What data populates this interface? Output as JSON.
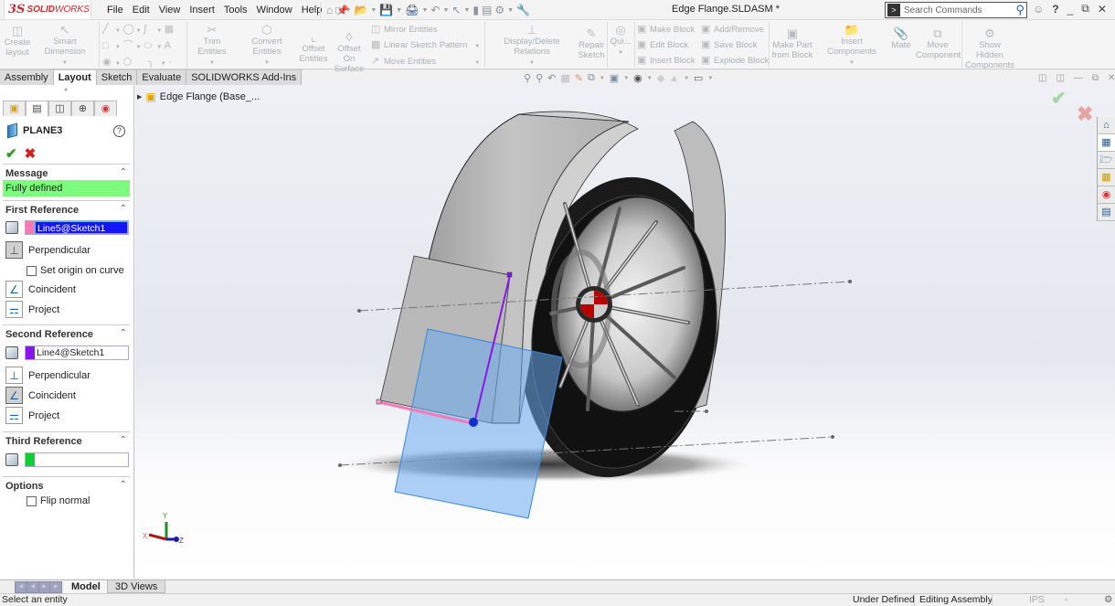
{
  "app": {
    "logo_ds": "3S",
    "logo_solid": "SOLID",
    "logo_works": "WORKS",
    "document_title": "Edge Flange.SLDASM *"
  },
  "menu": [
    "File",
    "Edit",
    "View",
    "Insert",
    "Tools",
    "Window",
    "Help"
  ],
  "quick_access_icons": [
    "home-icon",
    "new-document-icon",
    "open-icon",
    "save-icon",
    "print-icon",
    "undo-icon",
    "select-icon",
    "rebuild-icon",
    "file-properties-icon",
    "options-icon",
    "measure-icon"
  ],
  "search": {
    "placeholder": "Search Commands"
  },
  "window_controls": {
    "user": "user-icon",
    "help": "?",
    "minimize": "_",
    "restore": "restore-icon",
    "close": "X"
  },
  "ribbon": {
    "create_layout": [
      "Create",
      "layout"
    ],
    "smart_dimension": "Smart Dimension",
    "trim_entities": "Trim Entities",
    "convert_entities": "Convert Entities",
    "offset_entities": [
      "Offset",
      "Entities"
    ],
    "offset_on_surface": [
      "Offset On",
      "Surface"
    ],
    "mirror_entities": "Mirror Entities",
    "linear_sketch_pattern": "Linear Sketch Pattern",
    "move_entities": "Move Entities",
    "display_delete_relations": "Display/Delete Relations",
    "repair_sketch": [
      "Repair",
      "Sketch"
    ],
    "quick_snaps": "Qui...",
    "make_block": "Make Block",
    "edit_block": "Edit Block",
    "insert_block": "Insert Block",
    "add_remove": "Add/Remove",
    "save_block": "Save Block",
    "explode_block": "Explode Block",
    "make_part_from_block": [
      "Make Part",
      "from Block"
    ],
    "insert_components": "Insert Components",
    "mate": "Mate",
    "move_component": [
      "Move",
      "Component"
    ],
    "show_hidden_components": [
      "Show Hidden",
      "Components"
    ]
  },
  "tabs": [
    {
      "label": "Assembly",
      "active": false
    },
    {
      "label": "Layout",
      "active": true
    },
    {
      "label": "Sketch",
      "active": false
    },
    {
      "label": "Evaluate",
      "active": false
    },
    {
      "label": "SOLIDWORKS Add-Ins",
      "active": false
    }
  ],
  "feature_tree": {
    "root": "Edge Flange  (Base_..."
  },
  "property_manager": {
    "title": "PLANE3",
    "message_header": "Message",
    "message": "Fully defined",
    "message_color": "#7dfb7d",
    "first_reference": {
      "header": "First Reference",
      "value": "Line5@Sketch1",
      "swatch": "#f47ab8",
      "options": [
        {
          "label": "Perpendicular",
          "active": true
        },
        {
          "label": "Coincident",
          "active": false
        },
        {
          "label": "Project",
          "active": false
        }
      ],
      "checkbox": {
        "label": "Set origin on curve",
        "checked": false
      }
    },
    "second_reference": {
      "header": "Second Reference",
      "value": "Line4@Sketch1",
      "swatch": "#8a14f0",
      "options": [
        {
          "label": "Perpendicular",
          "active": false
        },
        {
          "label": "Coincident",
          "active": true
        },
        {
          "label": "Project",
          "active": false
        }
      ]
    },
    "third_reference": {
      "header": "Third Reference",
      "value": "",
      "swatch": "#14cc3a"
    },
    "options_section": {
      "header": "Options",
      "flip_normal": {
        "label": "Flip normal",
        "checked": false
      }
    }
  },
  "triad": {
    "x": "X",
    "y": "Y",
    "z": "Z"
  },
  "bottom_tabs": [
    {
      "label": "Model",
      "active": true
    },
    {
      "label": "3D Views",
      "active": false
    }
  ],
  "status_bar": {
    "hint": "Select an entity",
    "definition": "Under Defined",
    "mode": "Editing Assembly",
    "units": "IPS",
    "units_dd": "-"
  }
}
